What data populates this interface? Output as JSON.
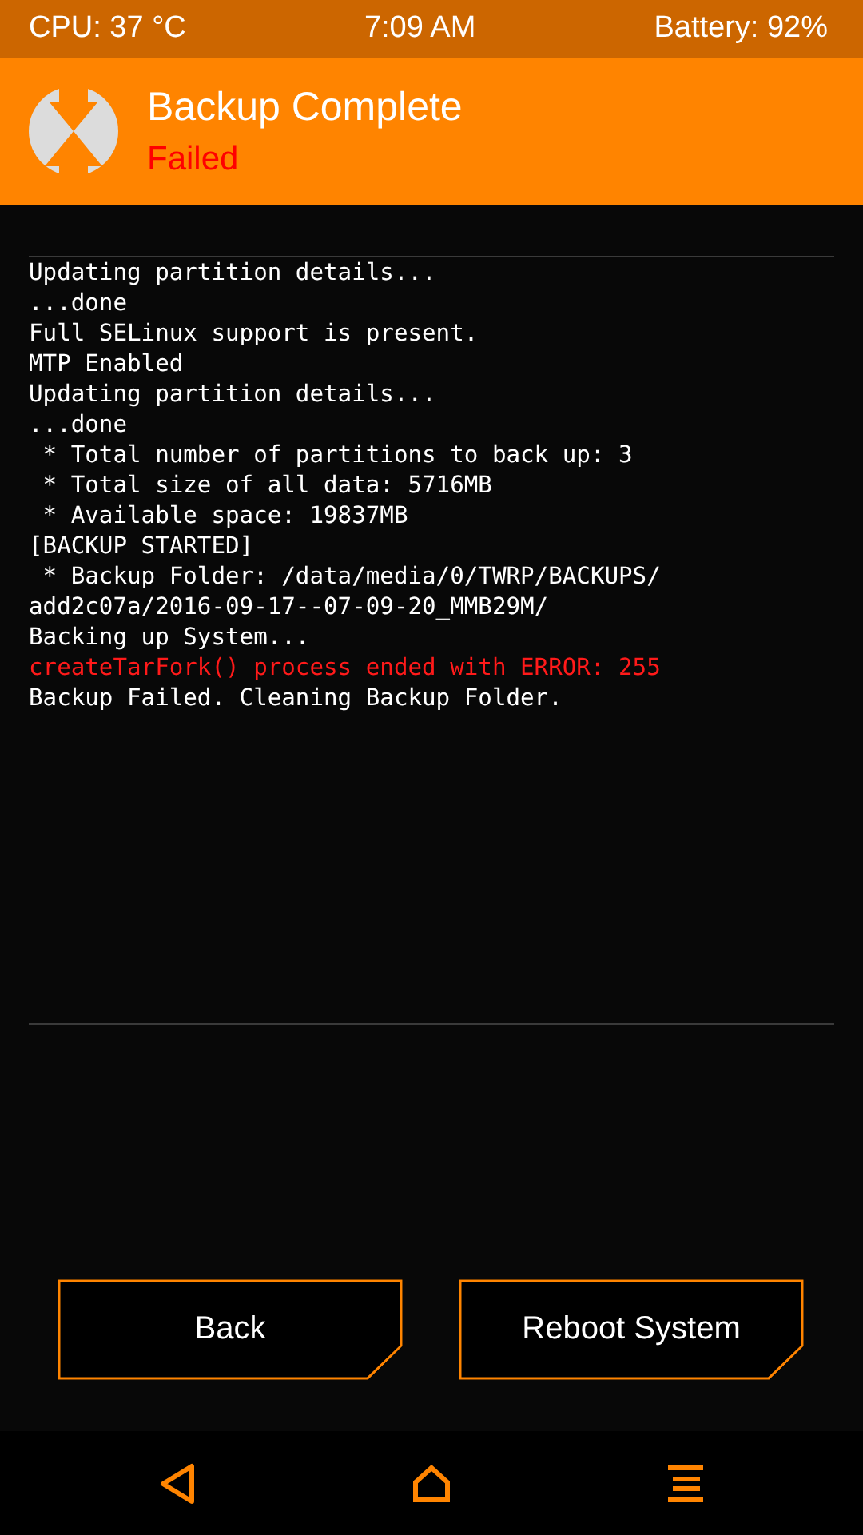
{
  "status_bar": {
    "cpu": "CPU: 37 °C",
    "time": "7:09 AM",
    "battery": "Battery: 92%"
  },
  "header": {
    "title": "Backup Complete",
    "status": "Failed",
    "kind": "error"
  },
  "log": [
    {
      "text": "Updating partition details...",
      "kind": "normal"
    },
    {
      "text": "...done",
      "kind": "normal"
    },
    {
      "text": "Full SELinux support is present.",
      "kind": "normal"
    },
    {
      "text": "MTP Enabled",
      "kind": "normal"
    },
    {
      "text": "Updating partition details...",
      "kind": "normal"
    },
    {
      "text": "...done",
      "kind": "normal"
    },
    {
      "text": " * Total number of partitions to back up: 3",
      "kind": "normal"
    },
    {
      "text": " * Total size of all data: 5716MB",
      "kind": "normal"
    },
    {
      "text": " * Available space: 19837MB",
      "kind": "normal"
    },
    {
      "text": "[BACKUP STARTED]",
      "kind": "normal"
    },
    {
      "text": " * Backup Folder: /data/media/0/TWRP/BACKUPS/",
      "kind": "normal"
    },
    {
      "text": "add2c07a/2016-09-17--07-09-20_MMB29M/",
      "kind": "normal"
    },
    {
      "text": "Backing up System...",
      "kind": "normal"
    },
    {
      "text": "createTarFork() process ended with ERROR: 255",
      "kind": "error"
    },
    {
      "text": "Backup Failed. Cleaning Backup Folder.",
      "kind": "normal"
    }
  ],
  "buttons": [
    "Back",
    "Reboot System"
  ]
}
